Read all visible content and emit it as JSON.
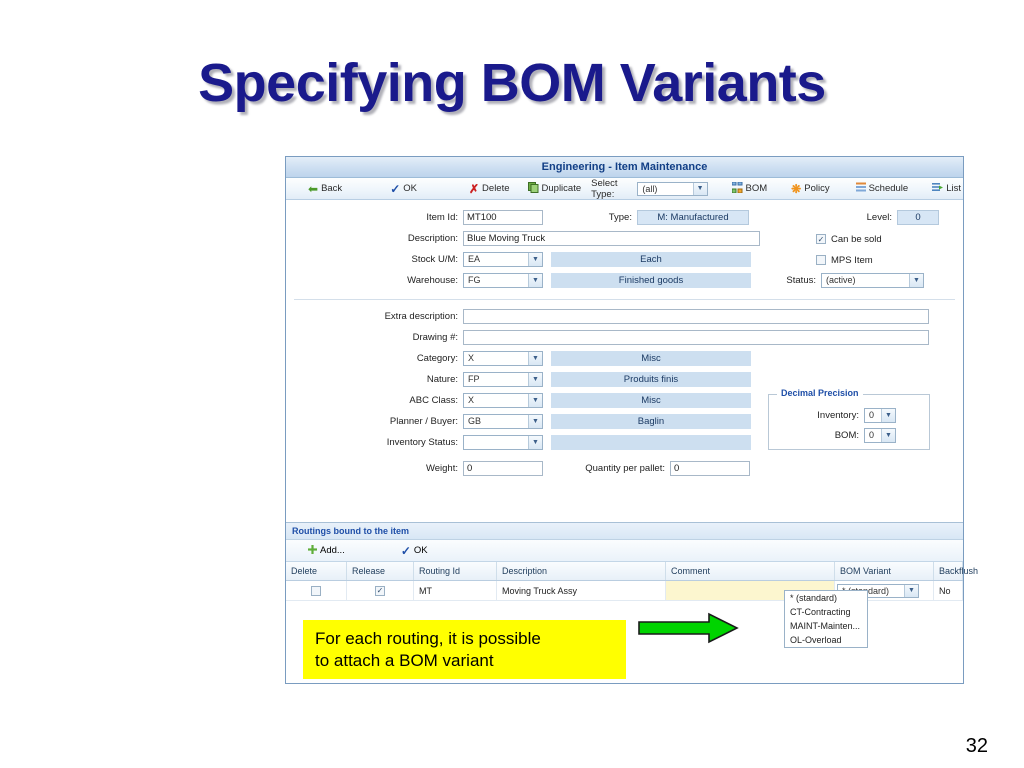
{
  "slide": {
    "title": "Specifying BOM Variants",
    "number": "32"
  },
  "colors": {
    "title_text": "#1a1a8c",
    "callout_bg": "#ffff00",
    "arrow_green": "#00d400",
    "accent_blue": "#1f4fa8",
    "readonly_blue": "#cddff0",
    "comment_yellow": "#fcf6cf"
  },
  "window": {
    "title": "Engineering - Item Maintenance",
    "toolbar": {
      "back": "Back",
      "ok": "OK",
      "delete": "Delete",
      "duplicate": "Duplicate",
      "select_type_label": "Select Type:",
      "select_type_value": "(all)",
      "bom": "BOM",
      "policy": "Policy",
      "schedule": "Schedule",
      "list": "List"
    },
    "fields": {
      "item_id_label": "Item Id:",
      "item_id_value": "MT100",
      "type_label": "Type:",
      "type_value": "M: Manufactured",
      "level_label": "Level:",
      "level_value": "0",
      "description_label": "Description:",
      "description_value": "Blue Moving Truck",
      "can_be_sold_label": "Can be sold",
      "mps_item_label": "MPS Item",
      "stock_um_label": "Stock U/M:",
      "stock_um_value": "EA",
      "stock_um_desc": "Each",
      "warehouse_label": "Warehouse:",
      "warehouse_value": "FG",
      "warehouse_desc": "Finished goods",
      "status_label": "Status:",
      "status_value": "(active)",
      "extra_description_label": "Extra description:",
      "extra_description_value": "",
      "drawing_label": "Drawing #:",
      "drawing_value": "",
      "category_label": "Category:",
      "category_value": "X",
      "category_desc": "Misc",
      "nature_label": "Nature:",
      "nature_value": "FP",
      "nature_desc": "Produits finis",
      "abc_class_label": "ABC Class:",
      "abc_class_value": "X",
      "abc_class_desc": "Misc",
      "planner_label": "Planner / Buyer:",
      "planner_value": "GB",
      "planner_desc": "Baglin",
      "inventory_status_label": "Inventory Status:",
      "inventory_status_value": "",
      "inventory_status_desc": "",
      "weight_label": "Weight:",
      "weight_value": "0",
      "qty_pallet_label": "Quantity per pallet:",
      "qty_pallet_value": "0"
    },
    "decimal_precision": {
      "title": "Decimal Precision",
      "inventory_label": "Inventory:",
      "inventory_value": "0",
      "bom_label": "BOM:",
      "bom_value": "0"
    },
    "routings": {
      "section_title": "Routings bound to the item",
      "add_label": "Add...",
      "ok_label": "OK",
      "columns": [
        "Delete",
        "Release",
        "Routing Id",
        "Description",
        "Comment",
        "BOM Variant",
        "Backflush"
      ],
      "rows": [
        {
          "delete_checked": false,
          "release_checked": true,
          "routing_id": "MT",
          "description": "Moving Truck Assy",
          "comment": "",
          "bom_variant": "* (standard)",
          "backflush": "No"
        }
      ],
      "bom_variant_options": [
        "* (standard)",
        "CT-Contracting",
        "MAINT-Mainten...",
        "OL-Overload"
      ]
    }
  },
  "callout": {
    "line1": "For each routing, it is possible",
    "line2": "to attach a BOM variant"
  }
}
